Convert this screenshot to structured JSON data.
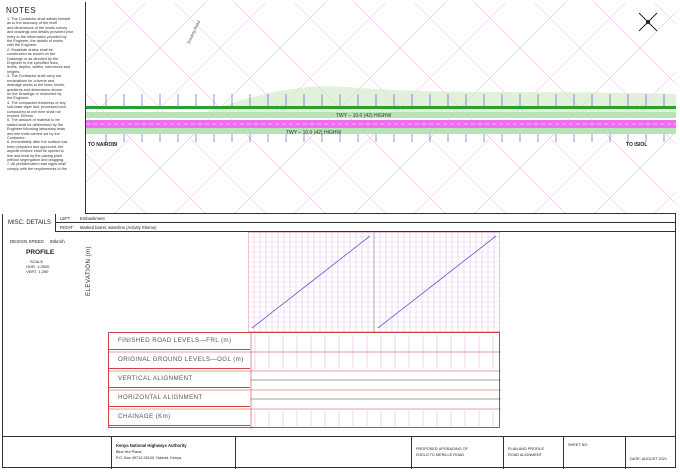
{
  "notes": {
    "title": "NOTES",
    "lines": [
      "1. The Contractor shall satisfy himself",
      "as to the accuracy of the level",
      "and dimensions of the levels survey",
      "and drawings and details provided prior",
      "entry to the information provided by",
      "the Engineer, the details of works",
      "with the Engineer.",
      "2. Roadside drains shall be",
      "constructed as shown on the",
      "Drawings or as directed by the",
      "Engineer to the specified lines,",
      "levels, depths, widths, tolerances and",
      "heights.",
      "3. The Contractor shall carry out",
      "excavations for culverts and",
      "drainage works to the lines, levels,",
      "gradients and dimensions shown",
      "on the Drawings or instructed by",
      "the Engineer.",
      "4. The compacted thickness of any",
      "sub-base layer laid, processed and",
      "compacted at one time shall not",
      "exceed 150mm.",
      "5. The amount of material to be",
      "stated shall be determined by the",
      "Engineer following laboratory tests",
      "and site trials carried out by the",
      "Contractor.",
      "6. Immediately after the surface has",
      "been prepared and approved, the",
      "asphalt mixture shall be spread to",
      "line and level by the paving plant",
      "without segregation and dragging.",
      "7. All prefabricated road signs shall",
      "comply with the requirements of the"
    ]
  },
  "plan": {
    "road_label_top": "TWY – 10.0 (42) HIGHW",
    "road_label_bottom": "TWY – 10.0 (42) HIGHW",
    "to_left": "TO NAIROBI",
    "to_right": "TO ISIOL",
    "road_name_diag": "Existing Road"
  },
  "misc": {
    "title": "MISC. DETAILS",
    "left_label": "LEFT",
    "left_value": "Embankment",
    "right_label": "RIGHT",
    "right_value": "Marked barrel, waterline (Activity Sheme)"
  },
  "profile": {
    "design_speed_label": "DESIGN SPEED",
    "design_speed_value": "80km/h",
    "title": "PROFILE",
    "scale_label": "SCALE",
    "scale_hor": "HOR. 1:2500",
    "scale_vert": "VERT. 1:250",
    "elevation_label": "ELEVATION (m)"
  },
  "bands": [
    "FINISHED ROAD LEVELS—FRL (m)",
    "ORIGINAL GROUND LEVELS—OGL (m)",
    "VERTICAL ALIGNMENT",
    "HORIZONTAL ALIGNMENT",
    "CHAINAGE (Km)"
  ],
  "chart_data": {
    "type": "line",
    "title": "",
    "xlabel": "",
    "ylabel": "ELEVATION (m)",
    "series": [
      {
        "values": [
          0,
          1,
          2,
          3,
          4,
          5,
          6,
          7,
          8,
          9,
          10
        ]
      },
      {
        "values": [
          0,
          1,
          2,
          3,
          4,
          5,
          6,
          7,
          8,
          9,
          10
        ]
      }
    ],
    "grid": true
  },
  "title_block": {
    "client": "Kenya National Highways Authority",
    "client_sub": "Blue Hut Plaza,",
    "client_addr": "P.O. Box 49712-00100, Nairobi, Kenya",
    "project": "PROPOSED UPGRADING OF",
    "project2": "ISIOLO TO MERILLE ROAD",
    "drawing": "PLAN AND PROFILE",
    "drawing2": "ROAD ALIGNMENT",
    "sheet_label": "SHEET NO.",
    "date": "DATE: AUGUST 2021"
  },
  "colors": {
    "magenta": "#e040e0",
    "pink_band": "#f06cf0",
    "green": "#2ca02c",
    "blue_line": "#5a5ad0",
    "red_band": "#cc4444"
  }
}
